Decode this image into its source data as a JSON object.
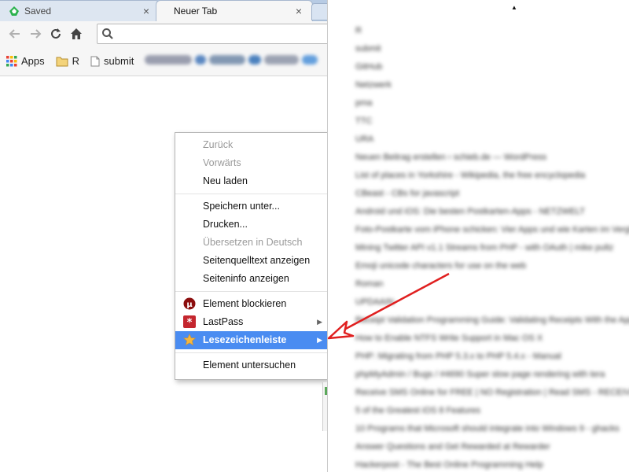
{
  "tabs": [
    {
      "label": "Saved",
      "close": "×"
    },
    {
      "label": "Neuer Tab",
      "close": "×"
    }
  ],
  "toolbar": {
    "back": "←",
    "forward": "→",
    "reload": "⟳",
    "home": "⌂"
  },
  "bookmarks": {
    "apps_label": "Apps",
    "folder_label": "R",
    "submit_label": "submit"
  },
  "context_menu": {
    "items": [
      {
        "label": "Zurück",
        "disabled": true
      },
      {
        "label": "Vorwärts",
        "disabled": true
      },
      {
        "label": "Neu laden"
      },
      {
        "label": "Speichern unter..."
      },
      {
        "label": "Drucken..."
      },
      {
        "label": "Übersetzen in Deutsch",
        "disabled": true
      },
      {
        "label": "Seitenquelltext anzeigen"
      },
      {
        "label": "Seiteninfo anzeigen"
      },
      {
        "label": "Element blockieren",
        "icon": "ublock-icon"
      },
      {
        "label": "LastPass",
        "icon": "lastpass-icon",
        "submenu": true
      },
      {
        "label": "Lesezeichenleiste",
        "icon": "star-icon",
        "submenu": true,
        "highlighted": true
      },
      {
        "label": "Element untersuchen"
      }
    ],
    "submenu_arrow": "▶"
  },
  "right_panel": {
    "caret": "▲",
    "entries": [
      "R",
      "submit",
      "GitHub",
      "Netzwerk",
      "pma",
      "TTC",
      "URA",
      "Neuen Beitrag erstellen ‹ schieb.de — WordPress",
      "List of places in Yorkshire - Wikipedia, the free encyclopedia",
      "CBeast - CBs for javascript",
      "Android und iOS: Die besten Postkarten-Apps - NETZWELT",
      "Foto-Postkarte vom iPhone schicken: Vier Apps und wie Karten im Vergleich",
      "Mining Twitter API v1.1 Streams from PHP - with OAuth | mike pultz",
      "Emoji unicode characters for use on the web",
      "Roman",
      "UPDAAIN",
      "Receipt Validation Programming Guide: Validating Receipts With the App Store",
      "How to Enable NTFS Write Support in Mac OS X",
      "PHP: Migrating from PHP 5.3.x to PHP 5.4.x - Manual",
      "phpMyAdmin / Bugs / #4690 Super slow page rendering with tera",
      "Receive SMS Online for FREE | NO Registration | Read SMS - RECEIVE",
      "5 of the Greatest iOS 8 Features",
      "10 Programs that Microsoft should integrate into Windows 9 - ghacks",
      "Answer Questions and Get Rewarded at Rewarder",
      "Hackerpost - The Best Online Programming Help"
    ]
  },
  "colors": {
    "highlight": "#4a8cf1",
    "annotation_arrow": "#e02020",
    "tabstrip": "#b7cbe4"
  }
}
